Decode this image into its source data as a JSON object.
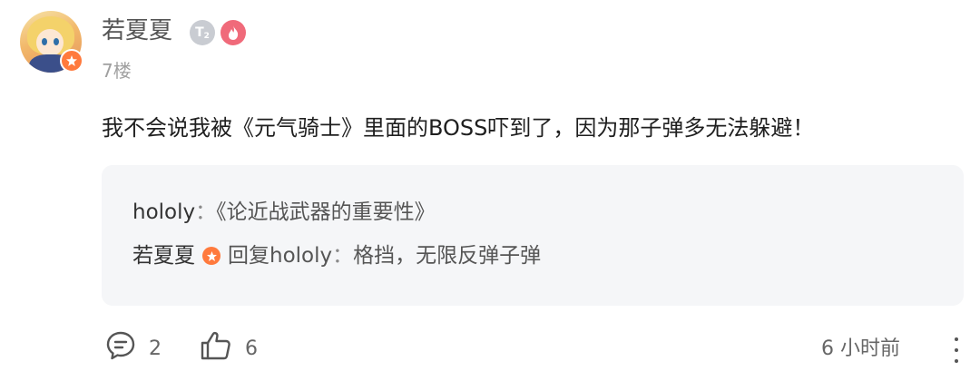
{
  "post": {
    "author": "若夏夏",
    "level_badge": "T",
    "level_sub": "2",
    "floor": "7楼",
    "content": "我不会说我被《元气骑士》里面的BOSS吓到了，因为那子弹多无法躲避！"
  },
  "replies": [
    {
      "name": "hololy",
      "separator": "：",
      "text": "《论近战武器的重要性》"
    },
    {
      "name": "若夏夏",
      "reply_prefix": "回复hololy",
      "separator": "：",
      "text": "格挡，无限反弹子弹"
    }
  ],
  "footer": {
    "comment_count": "2",
    "like_count": "6",
    "time": "6 小时前"
  },
  "icons": {
    "avatar_badge": "orange-star-badge-icon",
    "level_badge": "level-t2-badge-icon",
    "fire_badge": "fire-badge-icon",
    "comment": "comment-bubble-icon",
    "like": "thumbs-up-icon",
    "more": "more-vertical-icon"
  },
  "colors": {
    "accent_orange": "#ff7a3d",
    "fire_pink": "#f06a7a",
    "reply_background": "#f5f6f8"
  }
}
